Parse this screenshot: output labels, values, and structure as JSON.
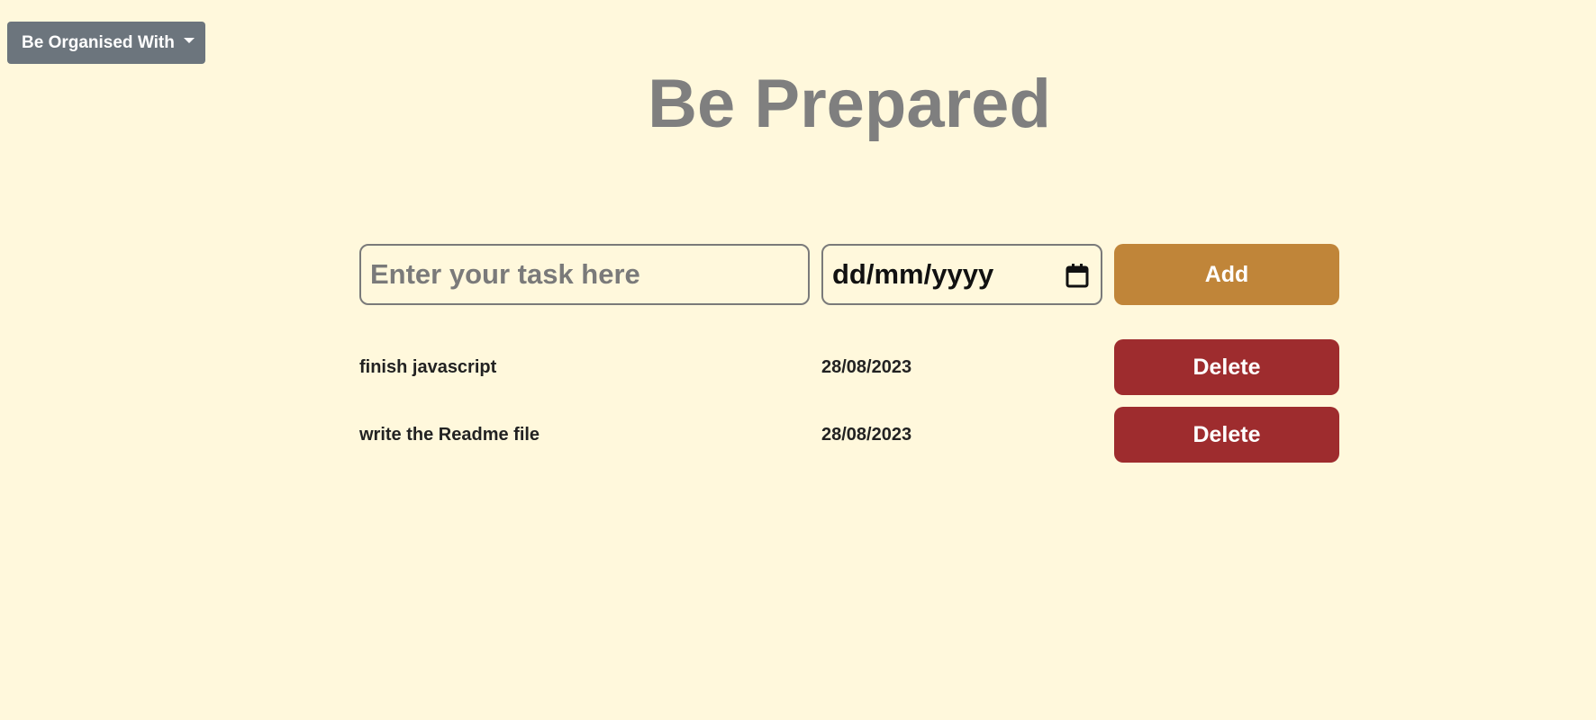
{
  "dropdown": {
    "label": "Be Organised With",
    "color": "#6c757d"
  },
  "header": {
    "title": "Be Prepared"
  },
  "form": {
    "task_placeholder": "Enter your task here",
    "date_placeholder": "dd/mm/yyyy",
    "add_label": "Add",
    "add_color": "#c08539"
  },
  "tasks": [
    {
      "name": "finish javascript",
      "date": "28/08/2023",
      "delete_label": "Delete"
    },
    {
      "name": "write the Readme file",
      "date": "28/08/2023",
      "delete_label": "Delete"
    }
  ],
  "colors": {
    "background": "#fff8dc",
    "delete": "#9e2c2e"
  },
  "icons": {
    "dropdown_caret": "chevron-down-icon",
    "date_picker": "calendar-icon"
  }
}
